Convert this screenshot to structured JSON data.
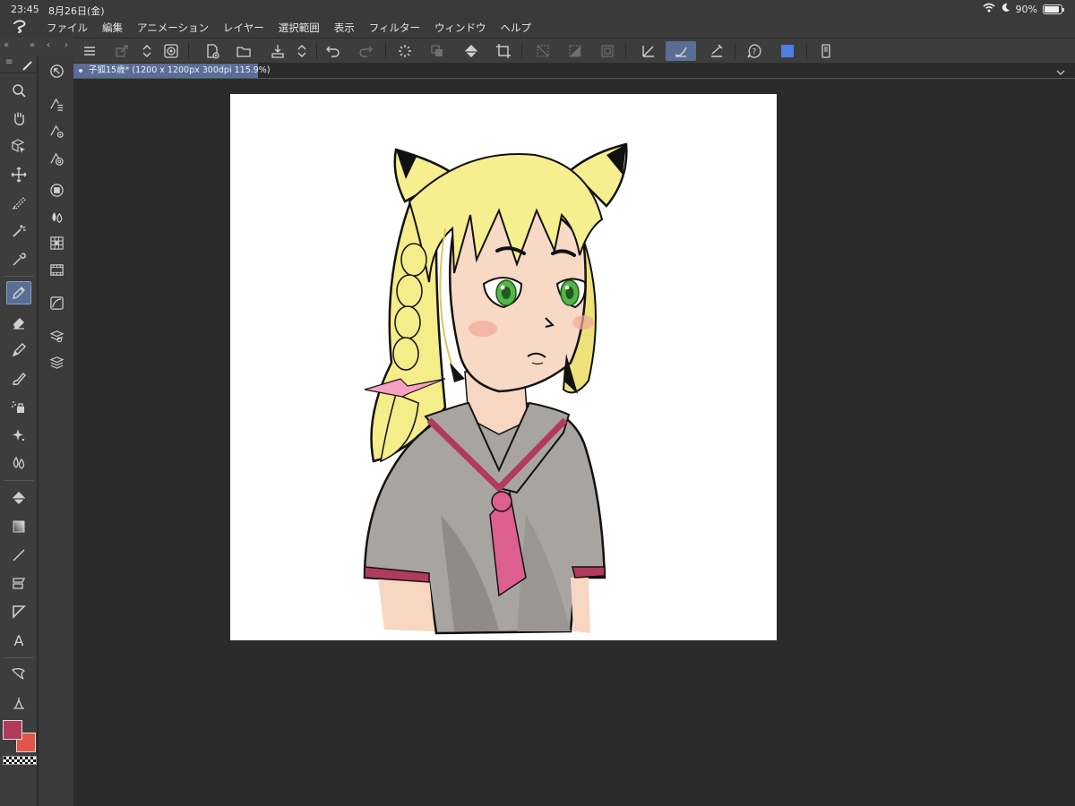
{
  "status": {
    "time": "23:45",
    "date": "8月26日(金)",
    "battery": "90%",
    "battery_level": 0.9
  },
  "menu": {
    "items": [
      "ファイル",
      "編集",
      "アニメーション",
      "レイヤー",
      "選択範囲",
      "表示",
      "フィルター",
      "ウィンドウ",
      "ヘルプ"
    ]
  },
  "document": {
    "tab_label": "子狐15歳* (1200 x 1200px 300dpi 115.9%)"
  },
  "colors": {
    "main_color": "#b23a5c",
    "sub_color": "#e25548",
    "toolbar_color_swatch": "#4f7fe0",
    "active_highlight": "#5a6d95"
  },
  "tools": [
    "zoom-icon",
    "hand-icon",
    "operation-icon",
    "move-icon",
    "selection-icon",
    "auto-select-icon",
    "eyedropper-icon",
    "pen-icon",
    "eraser-icon",
    "pencil-icon",
    "brush-icon",
    "airbrush-icon",
    "decoration-icon",
    "blend-icon",
    "fill-icon",
    "gradient-icon",
    "figure-icon",
    "frame-icon",
    "ruler-icon",
    "text-icon",
    "balloon-icon",
    "correct-line-icon"
  ],
  "panel_icons": [
    "sub-tool-icon",
    "tool-property-icon",
    "brush-size-icon",
    "color-wheel-icon",
    "color-set-icon",
    "intermediate-color-icon",
    "similar-color-icon",
    "navigator-icon",
    "layer-property-icon",
    "layer-icon"
  ],
  "lefthead": {
    "collapse_left": "«",
    "collapse_right": "»",
    "prev": "‹",
    "next": "›"
  }
}
